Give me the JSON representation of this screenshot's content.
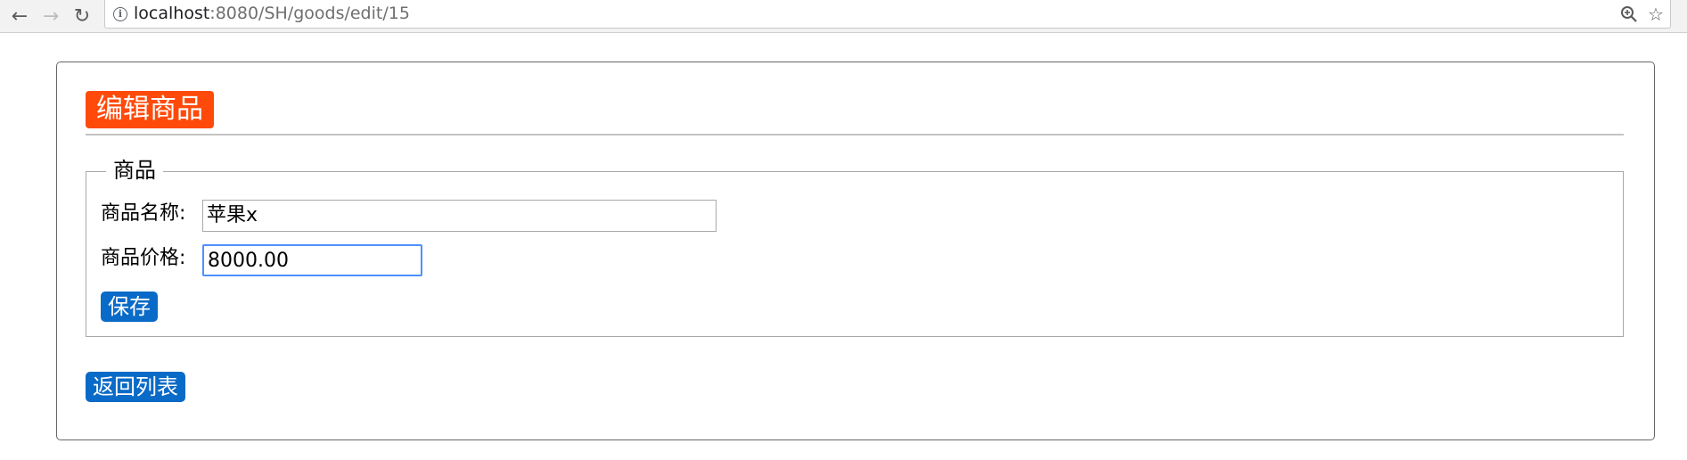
{
  "browser": {
    "url_host": "localhost",
    "url_path": ":8080/SH/goods/edit/15",
    "icons": [
      "back-arrow-icon",
      "forward-arrow-icon",
      "reload-icon",
      "info-icon",
      "zoom-icon",
      "star-icon"
    ]
  },
  "page": {
    "title": "编辑商品",
    "fieldset_legend": "商品",
    "fields": {
      "name_label": "商品名称:",
      "name_value": "苹果x",
      "price_label": "商品价格:",
      "price_value": "8000.00"
    },
    "save_button": "保存",
    "back_button": "返回列表"
  },
  "colors": {
    "title_bg": "#ff4a0a",
    "button_bg": "#0a6ac7",
    "focus_border": "#4d90fe"
  }
}
